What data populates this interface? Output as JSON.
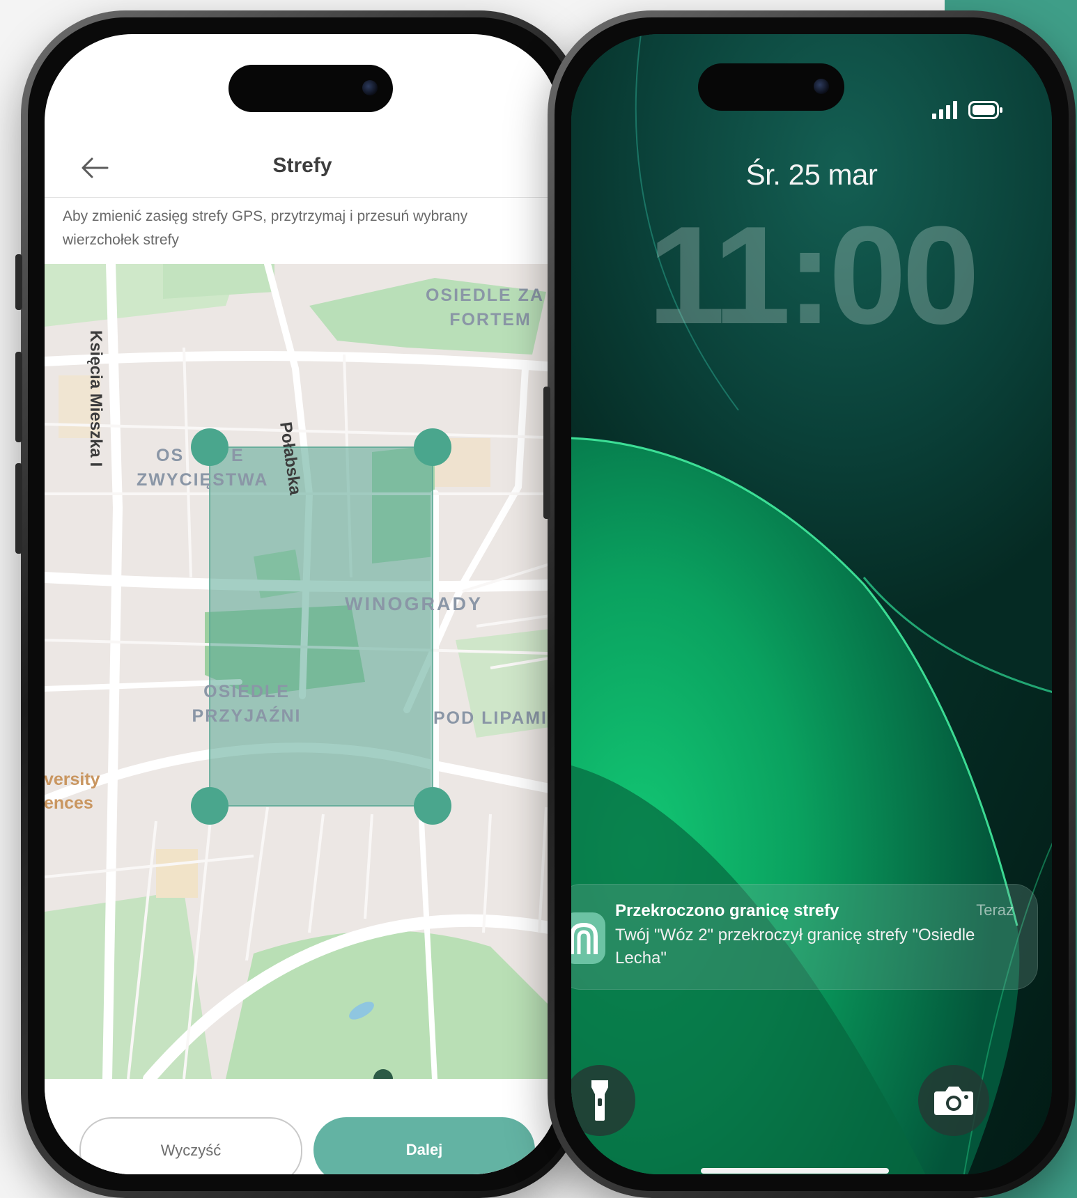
{
  "colors": {
    "accent": "#63b3a3",
    "zone_fill": "#5aa894",
    "zone_handle": "#4aa68d",
    "lock_bg_dark": "#032a22",
    "lock_bg_green": "#0fa162"
  },
  "app": {
    "back_icon": "arrow-left-icon",
    "title": "Strefy",
    "hint": "Aby zmienić zasięg strefy GPS, przytrzymaj i przesuń wybrany wierzchołek strefy",
    "map": {
      "labels": {
        "osiedle_za_fortem_1": "OSIEDLE ZA",
        "osiedle_za_fortem_2": "FORTEM",
        "ksiecia_mieszka": "Księcia Mieszka I",
        "polabska": "Połabska",
        "osiedle_zwyciestwa_1": "OS",
        "osiedle_zwyciestwa_1b": "E",
        "osiedle_zwyciestwa_2": "ZWYCIĘSTWA",
        "winogrady": "WINOGRADY",
        "osiedle_przyjazni_1": "OSIEDLE",
        "osiedle_przyjazni_2": "PRZYJAŹNI",
        "pod_lipami": "POD LIPAMI",
        "university_1": "iversity",
        "university_2": "iences"
      }
    },
    "buttons": {
      "clear": "Wyczyść",
      "next": "Dalej"
    }
  },
  "lock": {
    "date": "Śr. 25 mar",
    "time": "11:00",
    "status_icons": [
      "signal-icon",
      "battery-icon"
    ],
    "notification": {
      "title": "Przekroczono granicę strefy",
      "time": "Teraz",
      "body": "Twój \"Wóz 2\" przekroczył granicę strefy \"Osiedle Lecha\""
    },
    "quick_actions": [
      "flashlight-icon",
      "camera-icon"
    ]
  }
}
